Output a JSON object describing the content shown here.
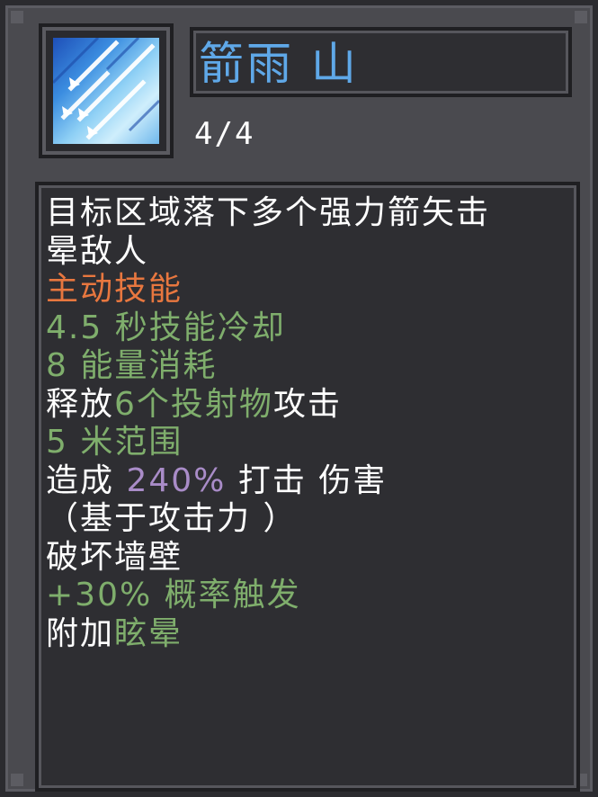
{
  "skill": {
    "name": "箭雨 山",
    "level": "4/4",
    "icon": "arrow-rain-icon"
  },
  "colors": {
    "title": "#5fa8e8",
    "white": "#ffffff",
    "active": "#e8773f",
    "stat": "#7fae6c",
    "percent": "#a98cc8",
    "panel": "#4a4a4f",
    "inner": "#2e2e32"
  },
  "description": {
    "line1": "目标区域落下多个强力箭矢击",
    "line2": "晕敌人",
    "type": "主动技能",
    "cooldown": "4.5 秒技能冷却",
    "energy": "8 能量消耗",
    "release_prefix": "释放",
    "release_count": "6个",
    "release_projectile": "投射物",
    "release_suffix": "攻击",
    "range": "5 米范围",
    "damage_prefix": "造成 ",
    "damage_percent": "240%",
    "damage_suffix": " 打击 伤害",
    "damage_basis": "（基于攻击力 ）",
    "wall": "破坏墙壁",
    "chance": "+30% 概率触发",
    "extra_prefix": "附加",
    "extra_effect": "眩晕"
  }
}
